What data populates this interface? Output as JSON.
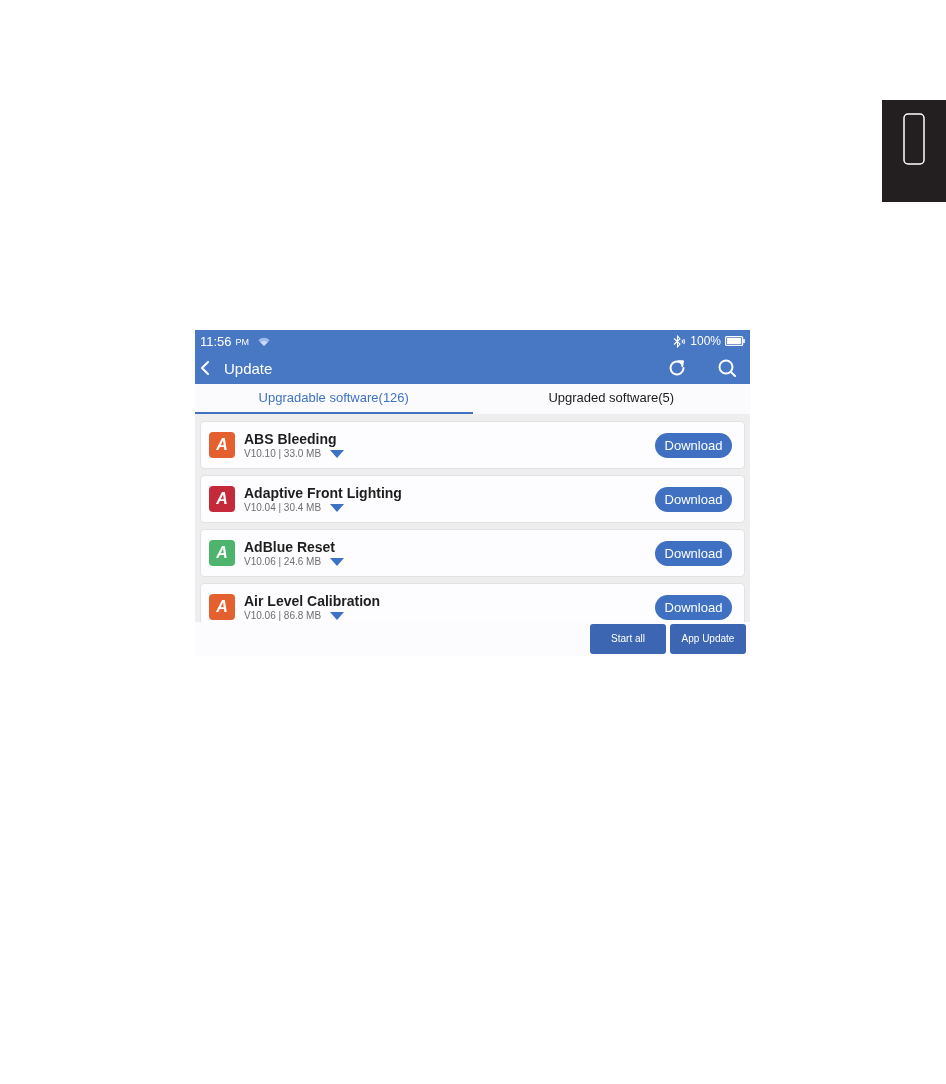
{
  "status_bar": {
    "time": "11:56",
    "meridiem": "PM",
    "battery": "100%"
  },
  "header": {
    "title": "Update"
  },
  "tabs": [
    {
      "label": "Upgradable software(126)",
      "selected": true
    },
    {
      "label": "Upgraded software(5)",
      "selected": false
    }
  ],
  "software": [
    {
      "letter": "A",
      "color": "#e5602f",
      "name": "ABS Bleeding",
      "details": "V10.10 | 33.0 MB",
      "action": "Download"
    },
    {
      "letter": "A",
      "color": "#c52a3b",
      "name": "Adaptive Front Lighting",
      "details": "V10.04 | 30.4 MB",
      "action": "Download"
    },
    {
      "letter": "A",
      "color": "#4db46d",
      "name": "AdBlue Reset",
      "details": "V10.06 | 24.6 MB",
      "action": "Download"
    },
    {
      "letter": "A",
      "color": "#e5602f",
      "name": "Air Level Calibration",
      "details": "V10.06 | 86.8 MB",
      "action": "Download"
    }
  ],
  "footer_buttons": [
    "Start all",
    "App Update"
  ]
}
